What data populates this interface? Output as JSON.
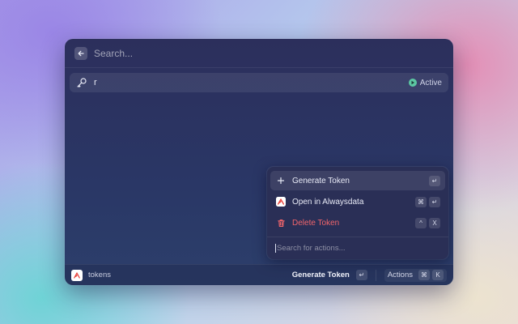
{
  "search": {
    "placeholder": "Search..."
  },
  "list": {
    "items": [
      {
        "title": "r",
        "icon": "key-icon",
        "status": "Active",
        "status_color": "#5cc7a3"
      }
    ]
  },
  "actions_panel": {
    "items": [
      {
        "label": "Generate Token",
        "icon": "plus-icon",
        "shortcut": [
          "↵"
        ],
        "selected": true
      },
      {
        "label": "Open in Alwaysdata",
        "icon": "alwaysdata-logo-icon",
        "shortcut": [
          "⌘",
          "↵"
        ]
      },
      {
        "label": "Delete Token",
        "icon": "trash-icon",
        "shortcut": [
          "^",
          "X"
        ],
        "color": "#f2656b"
      }
    ],
    "search_placeholder": "Search for actions..."
  },
  "footer": {
    "title": "tokens",
    "primary_action": "Generate Token",
    "primary_shortcut": "↵",
    "actions_label": "Actions",
    "actions_shortcut": [
      "⌘",
      "K"
    ]
  },
  "colors": {
    "accent": "#5cc7a3",
    "danger": "#f2656b",
    "brand": "#e8423c"
  }
}
